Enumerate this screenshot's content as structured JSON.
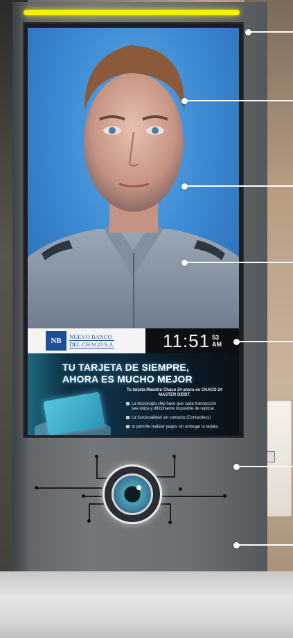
{
  "bank": {
    "logo_mark": "NB",
    "name_line1": "NUEVO BANCO",
    "name_line2": "DEL CHACO S.A."
  },
  "clock": {
    "time": "11:51",
    "seconds": "53",
    "period": "AM"
  },
  "ad": {
    "headline_line1": "TU TARJETA DE SIEMPRE,",
    "headline_line2": "AHORA ES MUCHO MEJOR",
    "promo_title": "Tu tarjeta Maestro Chaco 24 ahora es CHACO 24 MASTER DEBIT.",
    "promo_lines": [
      "La tecnología chip hace que cada transacción sea única y difícilmente imposible de replicar.",
      "La funcionalidad sin contacto (Contactless)",
      "te permite realizar pagos sin entregar la tarjeta."
    ]
  },
  "colors": {
    "led_strip": "#f3f000",
    "portrait_bg": "#3a86d0",
    "bank_blue": "#1f4e98"
  },
  "icons": {
    "eye_sensor": "eye-scanner-icon"
  }
}
